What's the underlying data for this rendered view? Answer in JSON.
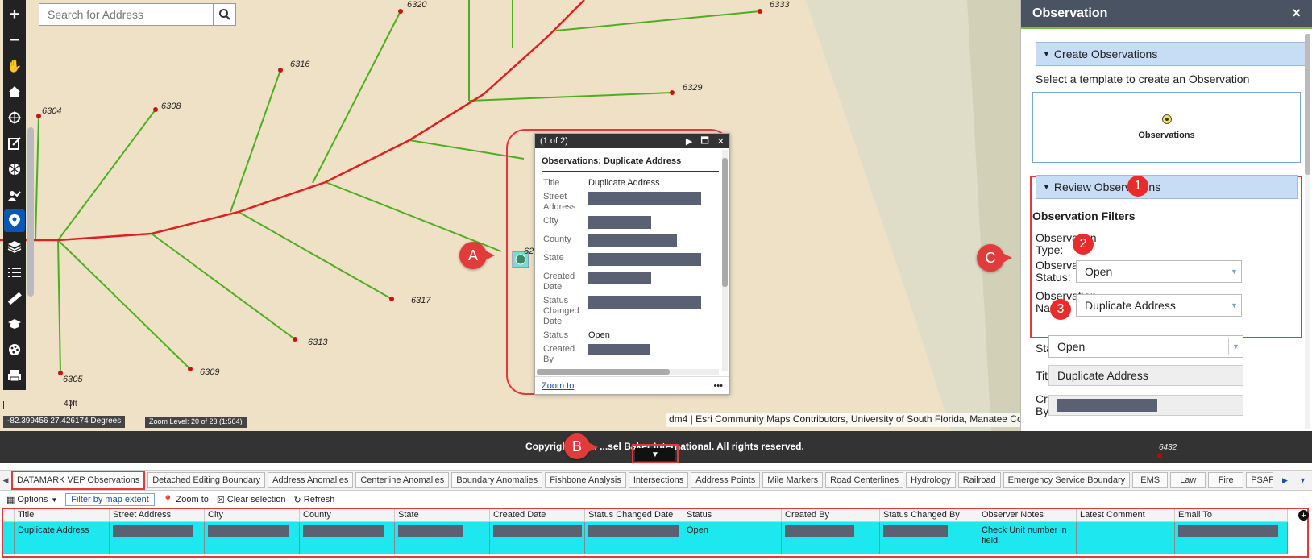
{
  "map": {
    "search_placeholder": "Search for Address",
    "coordinates": "-82.399456 27.426174 Degrees",
    "zoom_level": "Zoom Level: 20 of 23 (1:564)",
    "scale_label": "40ft",
    "attribution": "dm4 | Esri Community Maps Contributors, University of South Florida, Manatee Co",
    "parcel_labels": [
      "6320",
      "6333",
      "6316",
      "6329",
      "6304",
      "6308",
      "6317",
      "6313",
      "6309",
      "6305",
      "62"
    ],
    "callouts": {
      "a": "A",
      "b": "B",
      "c": "C"
    }
  },
  "toolbar": {
    "tools": [
      "zoom-in",
      "zoom-out",
      "pan",
      "home",
      "locate",
      "edit",
      "basemap",
      "user-check",
      "observations",
      "layers",
      "list",
      "measure",
      "graduation",
      "palette",
      "print"
    ]
  },
  "popup": {
    "counter": "(1 of 2)",
    "subtitle": "Observations: Duplicate Address",
    "fields": [
      {
        "label": "Title",
        "value": "Duplicate Address"
      },
      {
        "label": "Street Address",
        "value": ""
      },
      {
        "label": "City",
        "value": ""
      },
      {
        "label": "County",
        "value": ""
      },
      {
        "label": "State",
        "value": ""
      },
      {
        "label": "Created Date",
        "value": ""
      },
      {
        "label": "Status Changed Date",
        "value": ""
      },
      {
        "label": "Status",
        "value": "Open"
      },
      {
        "label": "Created By",
        "value": ""
      }
    ],
    "zoom_link": "Zoom to",
    "more": "•••"
  },
  "panel": {
    "title": "Observation",
    "close": "×",
    "create_header": "Create Observations",
    "create_instruction": "Select a template to create an Observation",
    "template_label": "Observations",
    "review_header": "Review Observations",
    "filters_title": "Observation Filters",
    "type_label": "Observation Type:",
    "status_label": "Observation Status:",
    "status_value": "Open",
    "name_label": "Observation Name:",
    "name_value": "Duplicate Address",
    "badges": [
      "1",
      "2",
      "3"
    ],
    "form_status_label": "Status",
    "form_status_value": "Open",
    "form_title_label": "Title",
    "form_title_value": "Duplicate Address",
    "form_created_label": "Created By"
  },
  "footer": {
    "copyright": "Copyright © 2... ...sel Baker International. All rights reserved.",
    "toggle_glyph": "▼",
    "map_label": "6432"
  },
  "tabs": [
    "DATAMARK VEP Observations",
    "Detached Editing Boundary",
    "Address Anomalies",
    "Centerline Anomalies",
    "Boundary Anomalies",
    "Fishbone Analysis",
    "Intersections",
    "Address Points",
    "Mile Markers",
    "Road Centerlines",
    "Hydrology",
    "Railroad",
    "Emergency Service Boundary",
    "EMS",
    "Law",
    "Fire",
    "PSAP"
  ],
  "attr_toolbar": {
    "options": "Options",
    "filter": "Filter by map extent",
    "zoom": "Zoom to",
    "clear": "Clear selection",
    "refresh": "Refresh"
  },
  "grid": {
    "columns": [
      "Title",
      "Street Address",
      "City",
      "County",
      "State",
      "Created Date",
      "Status Changed Date",
      "Status",
      "Created By",
      "Status Changed By",
      "Observer Notes",
      "Latest Comment",
      "Email To"
    ],
    "row": [
      "Duplicate Address",
      "",
      "",
      "",
      "",
      "",
      "",
      "Open",
      "",
      "",
      "Check Unit number in field.",
      "",
      ""
    ]
  },
  "colors": {
    "accent_red": "#e03a3a",
    "selection": "#1de8f0",
    "header_dark": "#4a5362",
    "section_blue": "#c7dcf5",
    "line_green": "#4caf1f",
    "road_red": "#e02020"
  }
}
